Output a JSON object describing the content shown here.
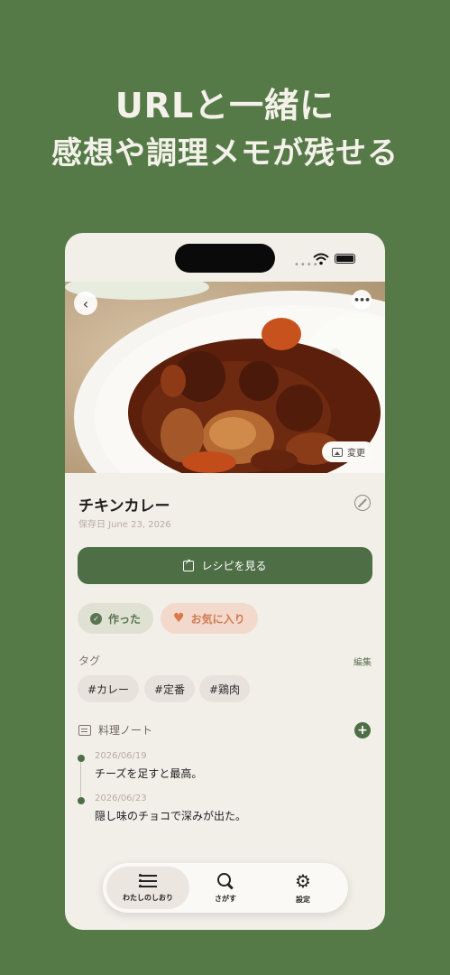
{
  "headline": {
    "line1": "URLと一緒に",
    "line2": "感想や調理メモが残せる"
  },
  "status_bar": {
    "signal": "••••"
  },
  "hero": {
    "change_label": "変更"
  },
  "recipe": {
    "title": "チキンカレー",
    "saved_date": "保存日 June 23, 2026",
    "open_recipe_label": "レシピを見る"
  },
  "chips": {
    "made_label": "作った",
    "favorite_label": "お気に入り"
  },
  "tags": {
    "section_label": "タグ",
    "edit_label": "編集",
    "items": [
      "#カレー",
      "#定番",
      "#鶏肉"
    ]
  },
  "notes": {
    "section_label": "料理ノート",
    "items": [
      {
        "date": "2026/06/19",
        "text": "チーズを足すと最高。"
      },
      {
        "date": "2026/06/23",
        "text": "隠し味のチョコで深みが出た。"
      }
    ]
  },
  "tabbar": {
    "tabs": [
      {
        "label": "わたしのしおり",
        "icon": "list-icon",
        "active": true
      },
      {
        "label": "さがす",
        "icon": "search-icon",
        "active": false
      },
      {
        "label": "設定",
        "icon": "gear-icon",
        "active": false
      }
    ]
  },
  "colors": {
    "background": "#557a47",
    "accent": "#4e6e45",
    "favorite": "#d9794c"
  }
}
